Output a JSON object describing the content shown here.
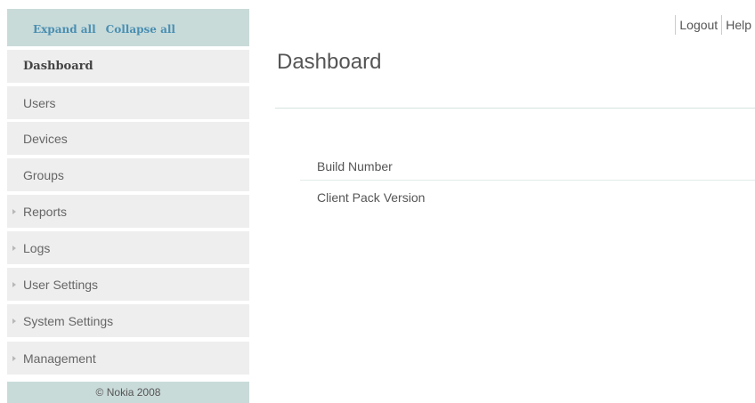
{
  "sidebar": {
    "expand_all": "Expand all",
    "collapse_all": "Collapse all",
    "items": [
      {
        "label": "Dashboard",
        "active": true,
        "expandable": false
      },
      {
        "label": "Users",
        "active": false,
        "expandable": false
      },
      {
        "label": "Devices",
        "active": false,
        "expandable": false
      },
      {
        "label": "Groups",
        "active": false,
        "expandable": false
      },
      {
        "label": "Reports",
        "active": false,
        "expandable": true
      },
      {
        "label": "Logs",
        "active": false,
        "expandable": true
      },
      {
        "label": "User Settings",
        "active": false,
        "expandable": true
      },
      {
        "label": "System Settings",
        "active": false,
        "expandable": true
      },
      {
        "label": "Management",
        "active": false,
        "expandable": true
      }
    ],
    "footer": "© Nokia 2008"
  },
  "header": {
    "logout": "Logout",
    "help": "Help"
  },
  "main": {
    "title": "Dashboard",
    "rows": [
      {
        "label": "Build Number",
        "value": ""
      },
      {
        "label": "Client Pack Version",
        "value": ""
      }
    ]
  },
  "colors": {
    "sidebar_header_bg": "#c9dbd9",
    "nav_item_bg": "#eeeeee",
    "link_color": "#4a8fb2"
  }
}
